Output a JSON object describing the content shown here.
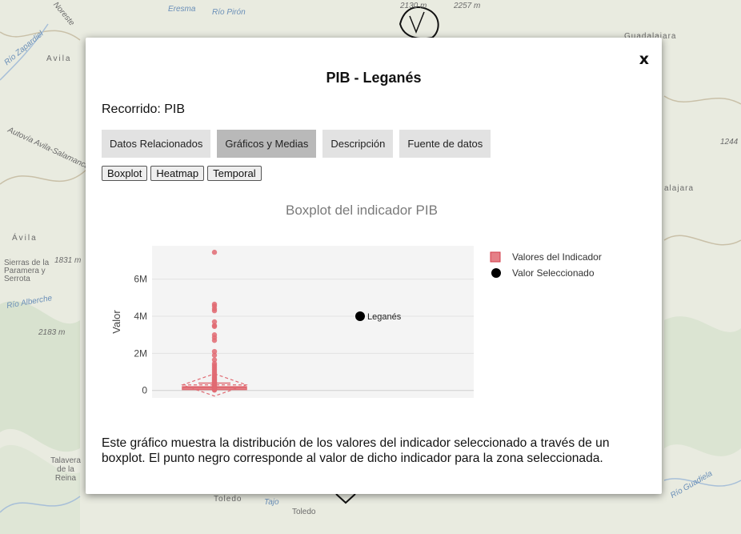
{
  "map": {
    "labels": [
      "2130 m",
      "2257 m",
      "Eresma",
      "Río Pirón",
      "Río Zapardiel",
      "Noreste",
      "Avila",
      "Guadalajara",
      "Autovía Avila-Salamanca",
      "1244",
      "alajara",
      "Ávila",
      "Sierras de la Paramera y Serrota",
      "1831 m",
      "Río Alberche",
      "2183 m",
      "Talavera de la Reina",
      "Toledo",
      "Tajo",
      "Río Guadiela"
    ]
  },
  "modal": {
    "close": "x",
    "title": "PIB - Leganés",
    "recorrido": "Recorrido: PIB",
    "tabs": [
      "Datos Relacionados",
      "Gráficos y Medias",
      "Descripción",
      "Fuente de datos"
    ],
    "active_tab": 1,
    "subtabs": [
      "Boxplot",
      "Heatmap",
      "Temporal"
    ],
    "description": "Este gráfico muestra la distribución de los valores del indicador seleccionado a través de un boxplot. El punto negro corresponde al valor de dicho indicador para la zona seleccionada."
  },
  "chart_data": {
    "type": "box",
    "title": "Boxplot del indicador PIB",
    "xlabel": "",
    "ylabel": "Valor",
    "ylim": [
      -400000,
      7800000
    ],
    "yticks": [
      0,
      2000000,
      4000000,
      6000000
    ],
    "ytick_labels": [
      "0",
      "2M",
      "4M",
      "6M"
    ],
    "grid": true,
    "legend_position": "right",
    "series": [
      {
        "name": "Valores del Indicador",
        "color": "#e06a72",
        "box": {
          "min": 5000,
          "q1": 50000,
          "median": 140000,
          "q3": 200000,
          "max": 400000,
          "mean": 300000,
          "sd": 600000
        },
        "points": [
          7450000,
          4650000,
          4550000,
          4400000,
          4300000,
          3700000,
          3500000,
          3450000,
          3000000,
          2850000,
          2700000,
          2100000,
          1900000,
          1650000,
          1450000,
          1350000,
          1250000,
          1150000,
          1050000,
          950000,
          850000,
          780000,
          700000,
          650000,
          600000,
          550000,
          500000,
          450000,
          420000,
          380000,
          320000,
          280000,
          240000,
          200000,
          170000,
          150000,
          120000,
          100000,
          80000,
          60000,
          40000,
          20000
        ]
      },
      {
        "name": "Valor Seleccionado",
        "color": "#000000",
        "point": {
          "label": "Leganés",
          "value": 4000000
        }
      }
    ]
  }
}
